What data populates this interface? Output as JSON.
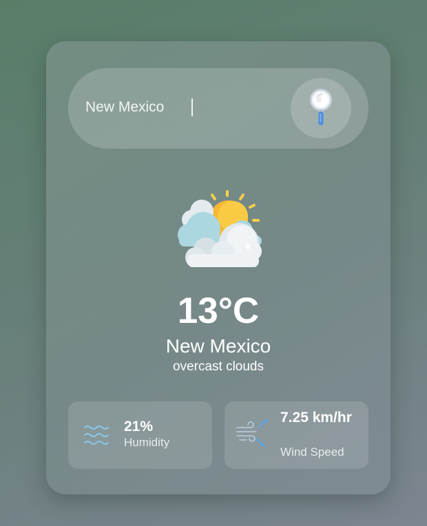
{
  "search": {
    "value": "New Mexico",
    "button_icon": "magnifier-icon"
  },
  "weather": {
    "icon": "partly-cloudy-sun-icon",
    "temperature": "13°C",
    "city": "New Mexico",
    "description": "overcast clouds"
  },
  "stats": {
    "humidity": {
      "icon": "humidity-waves-icon",
      "value": "21%",
      "label": "Humidity"
    },
    "wind": {
      "icon": "wind-icon",
      "value": "7.25 km/hr",
      "label": "Wind Speed"
    }
  },
  "colors": {
    "accent_blue": "#4a8ee0",
    "sun": "#f7b733",
    "cloud": "#eef2f5"
  }
}
